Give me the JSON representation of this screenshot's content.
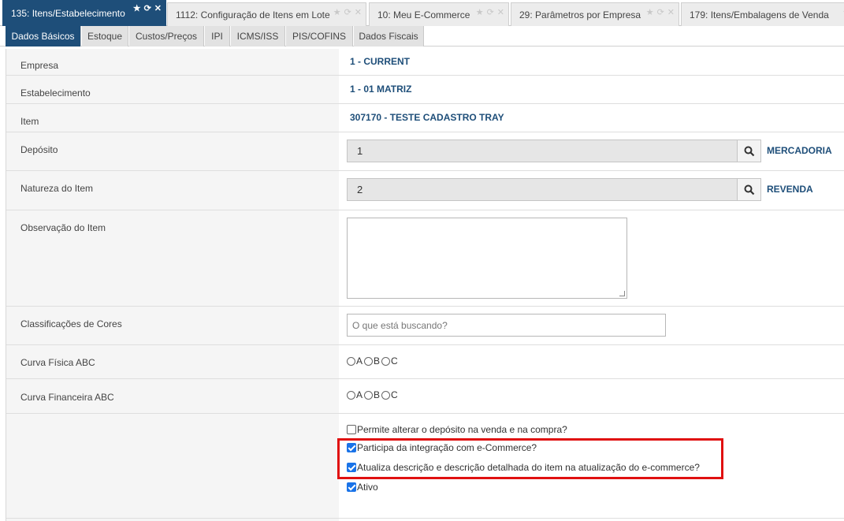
{
  "window_tabs": [
    {
      "label": "135: Itens/Estabelecimento",
      "active": true
    },
    {
      "label": "1112: Configuração de Itens em Lote",
      "active": false
    },
    {
      "label": "10: Meu E-Commerce",
      "active": false
    },
    {
      "label": "29: Parâmetros por Empresa",
      "active": false
    },
    {
      "label": "179: Itens/Embalagens de Venda",
      "active": false
    }
  ],
  "sub_tabs": [
    {
      "label": "Dados Básicos",
      "active": true
    },
    {
      "label": "Estoque",
      "active": false
    },
    {
      "label": "Custos/Preços",
      "active": false
    },
    {
      "label": "IPI",
      "active": false
    },
    {
      "label": "ICMS/ISS",
      "active": false
    },
    {
      "label": "PIS/COFINS",
      "active": false
    },
    {
      "label": "Dados Fiscais",
      "active": false
    }
  ],
  "form": {
    "empresa": {
      "label": "Empresa",
      "value": "1 - CURRENT"
    },
    "estabelecimento": {
      "label": "Estabelecimento",
      "value": "1 - 01 MATRIZ"
    },
    "item": {
      "label": "Item",
      "value": "307170 - TESTE CADASTRO TRAY"
    },
    "deposito": {
      "label": "Depósito",
      "value": "1",
      "description": "MERCADORIA"
    },
    "natureza": {
      "label": "Natureza do Item",
      "value": "2",
      "description": "REVENDA"
    },
    "observacao": {
      "label": "Observação do Item",
      "value": ""
    },
    "classificacoes": {
      "label": "Classificações de Cores",
      "placeholder": "O que está buscando?"
    },
    "curva_fisica": {
      "label": "Curva Física ABC",
      "options": [
        "A",
        "B",
        "C"
      ]
    },
    "curva_financeira": {
      "label": "Curva Financeira ABC",
      "options": [
        "A",
        "B",
        "C"
      ]
    },
    "checkboxes": [
      {
        "label": "Permite alterar o depósito na venda e na compra?",
        "checked": false
      },
      {
        "label": "Participa da integração com e-Commerce?",
        "checked": true
      },
      {
        "label": "Atualiza descrição e descrição detalhada do item na atualização do e-commerce?",
        "checked": true
      },
      {
        "label": "Ativo",
        "checked": true
      }
    ]
  },
  "colors": {
    "accent": "#1e4e79",
    "highlight": "#e01010",
    "checkbox": "#1a73e8"
  }
}
